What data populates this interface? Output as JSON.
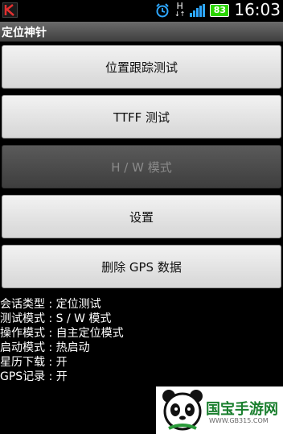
{
  "status_bar": {
    "time": "16:03",
    "battery": "83",
    "network": "H",
    "app_icon": "k-app-icon",
    "alarm_icon": "alarm-clock-icon",
    "colors": {
      "battery": "#2bd400",
      "signal": "#2ea7ff"
    }
  },
  "app": {
    "title": "定位神针"
  },
  "buttons": [
    {
      "label": "位置跟踪测试",
      "enabled": true
    },
    {
      "label": "TTFF 测试",
      "enabled": true
    },
    {
      "label": "H / W 模式",
      "enabled": false
    },
    {
      "label": "设置",
      "enabled": true
    },
    {
      "label": "删除 GPS 数据",
      "enabled": true
    }
  ],
  "info": [
    {
      "text": "会话类型 : 定位测试"
    },
    {
      "text": "测试模式 : S / W 模式"
    },
    {
      "text": "操作模式 : 自主定位模式"
    },
    {
      "text": "启动模式 : 热启动"
    },
    {
      "text": "星历下载 : 开"
    },
    {
      "text": "GPS记录 : 开"
    }
  ],
  "watermark": {
    "text": "国宝手游网",
    "url": "WWW.GB315.COM"
  }
}
